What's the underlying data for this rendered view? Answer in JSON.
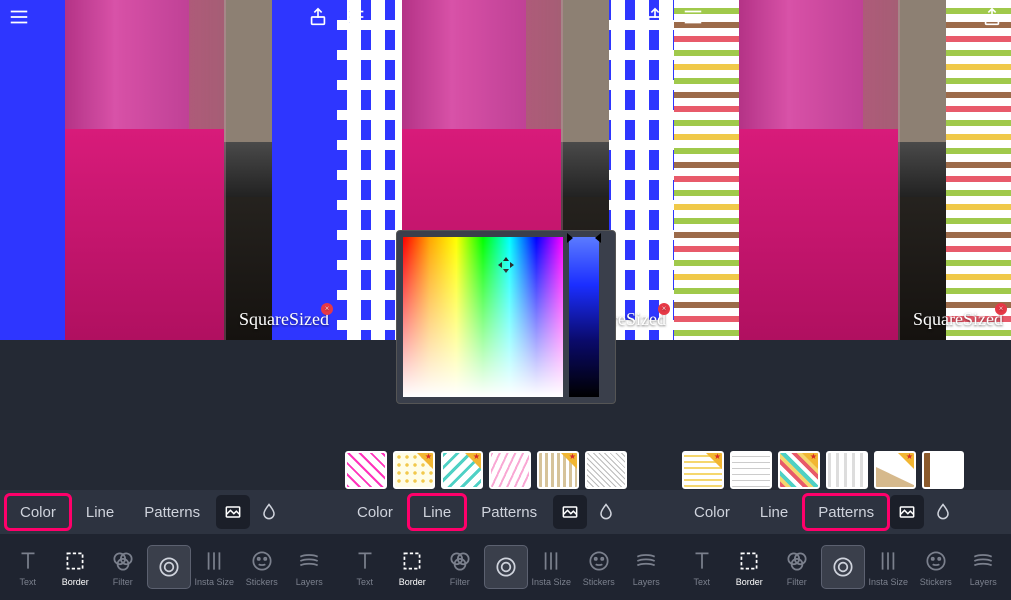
{
  "watermark": "SquareSized",
  "panels": [
    {
      "topLeftIcon": "menu-icon",
      "topRightIcon": "share-icon",
      "bg": "blue",
      "highlightTab": "Color"
    },
    {
      "topLeftIcon": "list-icon",
      "topRightIcon": "share-icon",
      "bg": "dash",
      "highlightTab": "Line"
    },
    {
      "topLeftIcon": "menu-icon",
      "topRightIcon": "share-icon",
      "bg": "stripes",
      "highlightTab": "Patterns"
    }
  ],
  "tabs": {
    "color": "Color",
    "line": "Line",
    "patterns": "Patterns",
    "imageIcon": "image-library-icon",
    "dropIcon": "blur-drop-icon"
  },
  "tools": {
    "text": "Text",
    "border": "Border",
    "filter": "Filter",
    "shape": "Shape",
    "instaSize": "Insta Size",
    "stickers": "Stickers",
    "layers": "Layers"
  },
  "patternThumbs": [
    {
      "kind": "wavy-pink",
      "premium": false
    },
    {
      "kind": "dots-yellow",
      "premium": true
    },
    {
      "kind": "diag-teal",
      "premium": true
    },
    {
      "kind": "zig-pink",
      "premium": false
    },
    {
      "kind": "chevron-tan",
      "premium": true
    },
    {
      "kind": "dense-grey",
      "premium": false
    },
    {
      "kind": "wave-yellow",
      "premium": true
    },
    {
      "kind": "grid-grey",
      "premium": false
    },
    {
      "kind": "diag-multi",
      "premium": true
    },
    {
      "kind": "stripe-grey",
      "premium": false
    },
    {
      "kind": "corner-tan",
      "premium": true
    },
    {
      "kind": "edge-brown",
      "premium": false
    }
  ]
}
